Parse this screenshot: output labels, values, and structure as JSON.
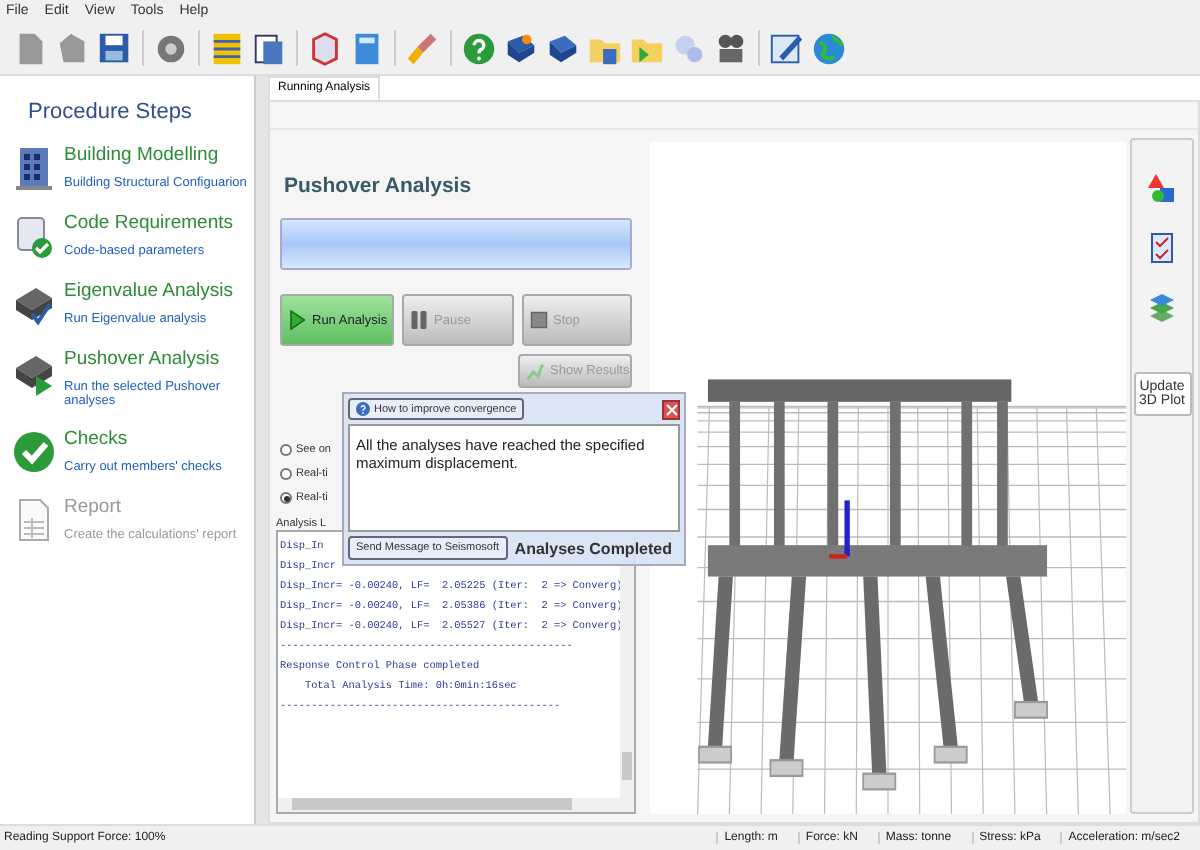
{
  "menu": [
    {
      "label": "File"
    },
    {
      "label": "Edit"
    },
    {
      "label": "View"
    },
    {
      "label": "Tools"
    },
    {
      "label": "Help"
    }
  ],
  "sidebar": {
    "title": "Procedure Steps",
    "steps": [
      {
        "kind": "building",
        "title": "Building Modelling",
        "subtitle": "Building Structural Configuarion",
        "disabled": false
      },
      {
        "kind": "code",
        "title": "Code Requirements",
        "subtitle": "Code-based parameters",
        "disabled": false
      },
      {
        "kind": "eigen",
        "title": "Eigenvalue Analysis",
        "subtitle": "Run Eigenvalue analysis",
        "disabled": false
      },
      {
        "kind": "pushover",
        "title": "Pushover Analysis",
        "subtitle": "Run the selected Pushover analyses",
        "disabled": false
      },
      {
        "kind": "checks",
        "title": "Checks",
        "subtitle": "Carry out members' checks",
        "disabled": false
      },
      {
        "kind": "report",
        "title": "Report",
        "subtitle": "Create the calculations' report",
        "disabled": true
      }
    ]
  },
  "tabs": [
    {
      "label": "Running Analysis",
      "selected": true
    }
  ],
  "analysis": {
    "title": "Pushover Analysis",
    "progress": {
      "level": 1
    },
    "buttons": [
      {
        "kind": "run",
        "label": "Run Analysis",
        "disabled": false
      },
      {
        "kind": "pause",
        "label": "Pause",
        "disabled": true
      },
      {
        "kind": "stop",
        "label": "Stop",
        "disabled": true
      }
    ],
    "show_results": {
      "label": "Show Results",
      "disabled": true
    },
    "options": [
      {
        "label": "See on",
        "selected": false
      },
      {
        "label": "Real-ti",
        "selected": false
      },
      {
        "label": "Real-ti",
        "selected": true
      }
    ],
    "log_label": "Analysis L",
    "log_lines": [
      {
        "text": "Disp_In"
      },
      {
        "text": "Disp_Incr"
      },
      {
        "text": "Disp_Incr= -0.00240, LF=  2.05225 (Iter:  2 => Converg)"
      },
      {
        "text": "Disp_Incr= -0.00240, LF=  2.05386 (Iter:  2 => Converg)"
      },
      {
        "text": "Disp_Incr= -0.00240, LF=  2.05527 (Iter:  2 => Converg)"
      },
      {
        "text": "-----------------------------------------------"
      },
      {
        "text": "Response Control Phase completed"
      },
      {
        "text": "    Total Analysis Time: 0h:0min:16sec"
      },
      {
        "text": "---------------------------------------------"
      }
    ]
  },
  "popup": {
    "help_button": "How to improve convergence",
    "message": "All the analyses have reached the specified maximum displacement.",
    "send_button": "Send Message to Seismosoft",
    "status": "Analyses Completed"
  },
  "view_toolbar": {
    "update_button": "Update 3D Plot"
  },
  "status_bar": {
    "message": "Reading Support Force: 100%",
    "units": [
      {
        "text": "Length: m"
      },
      {
        "text": "Force: kN"
      },
      {
        "text": "Mass: tonne"
      },
      {
        "text": "Stress: kPa"
      },
      {
        "text": "Acceleration: m/sec2"
      }
    ]
  }
}
